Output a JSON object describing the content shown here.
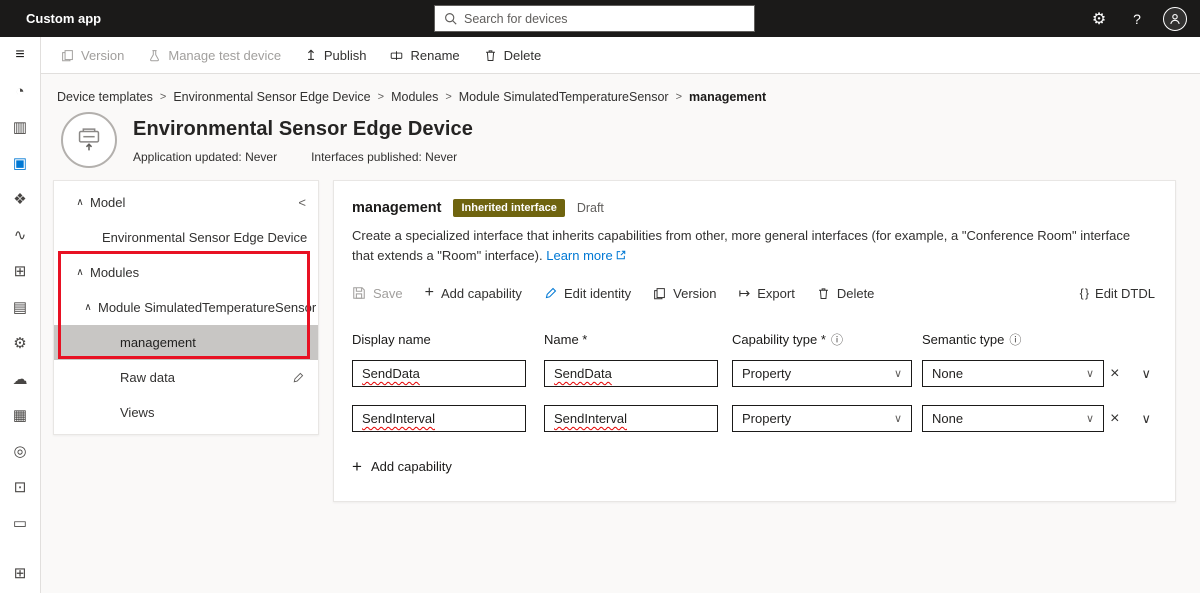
{
  "topbar": {
    "app_title": "Custom app",
    "search_placeholder": "Search for devices"
  },
  "glyphs": {
    "gear": "⚙",
    "help": "?",
    "breadcrumb_sep": ">",
    "chevron_up": "∧",
    "chevron_down": "∨",
    "collapse": "<",
    "close": "×",
    "plus": "+",
    "publish": "↥",
    "export": "↦",
    "info": "ⓘ",
    "braces": "{ }"
  },
  "sidebar": {
    "items": [
      {
        "name": "menu",
        "glyph": "≡"
      },
      {
        "name": "overview",
        "glyph": "◔"
      },
      {
        "name": "analytics",
        "glyph": "▥"
      },
      {
        "name": "device-templates",
        "glyph": "▣",
        "active": true
      },
      {
        "name": "device-groups",
        "glyph": "❖"
      },
      {
        "name": "data-explorer",
        "glyph": "∿"
      },
      {
        "name": "entities",
        "glyph": "⊞"
      },
      {
        "name": "forms",
        "glyph": "▤"
      },
      {
        "name": "jobs",
        "glyph": "⚙"
      },
      {
        "name": "connections",
        "glyph": "☁"
      },
      {
        "name": "audit-logs",
        "glyph": "▦"
      },
      {
        "name": "search",
        "glyph": "◎"
      },
      {
        "name": "deployments",
        "glyph": "⊡"
      },
      {
        "name": "monitor",
        "glyph": "▭"
      },
      {
        "name": "admin",
        "glyph": "⊞"
      }
    ]
  },
  "command_bar": {
    "items": [
      {
        "label": "Version",
        "disabled": true
      },
      {
        "label": "Manage test device",
        "disabled": true
      },
      {
        "label": "Publish",
        "disabled": false
      },
      {
        "label": "Rename",
        "disabled": false
      },
      {
        "label": "Delete",
        "disabled": false
      }
    ]
  },
  "breadcrumb": {
    "items": [
      "Device templates",
      "Environmental Sensor Edge Device",
      "Modules",
      "Module SimulatedTemperatureSensor",
      "management"
    ]
  },
  "header": {
    "title": "Environmental Sensor Edge Device",
    "app_updated": "Application updated: Never",
    "interfaces_published": "Interfaces published: Never"
  },
  "tree": {
    "model": "Model",
    "device": "Environmental Sensor Edge Device",
    "modules": "Modules",
    "module": "Module SimulatedTemperatureSensor",
    "management": "management",
    "raw_data": "Raw data",
    "views": "Views"
  },
  "panel": {
    "title": "management",
    "badge": "Inherited interface",
    "status": "Draft",
    "description": "Create a specialized interface that inherits capabilities from other, more general interfaces (for example, a \"Conference Room\" interface that extends a \"Room\" interface).",
    "learn_more": "Learn more",
    "toolbar": {
      "save": "Save",
      "add": "Add capability",
      "edit_identity": "Edit identity",
      "version": "Version",
      "export": "Export",
      "delete": "Delete",
      "edit_dtdl": "Edit DTDL"
    },
    "columns": {
      "display": "Display name",
      "name": "Name *",
      "capability": "Capability type *",
      "semantic": "Semantic type"
    },
    "rows": [
      {
        "display_name": "SendData",
        "name": "SendData",
        "capability_type": "Property",
        "semantic_type": "None"
      },
      {
        "display_name": "SendInterval",
        "name": "SendInterval",
        "capability_type": "Property",
        "semantic_type": "None"
      }
    ],
    "add_capability_footer": "Add capability"
  },
  "colors": {
    "accent": "#0078d4",
    "topbar_bg": "#1b1a19",
    "badge_bg": "#6f640f",
    "annotation_red": "#e81123",
    "selected_bg": "#c8c6c4"
  }
}
